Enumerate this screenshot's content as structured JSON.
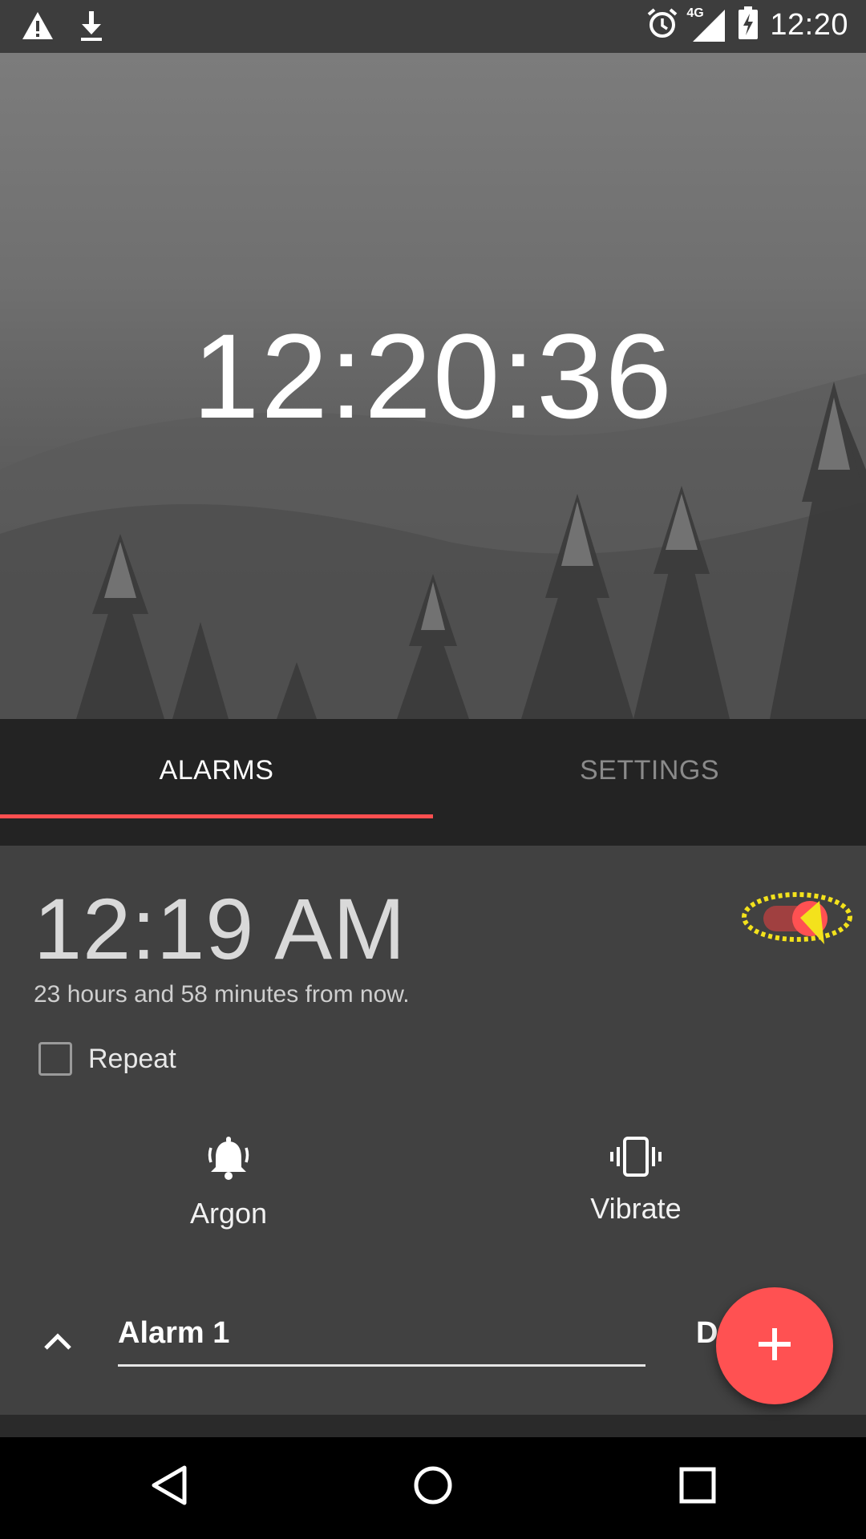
{
  "status_bar": {
    "time": "12:20",
    "network": "4G",
    "icons": [
      "warning-icon",
      "download-icon",
      "alarm-clock-icon",
      "signal-icon",
      "battery-charging-icon"
    ]
  },
  "hero": {
    "clock": "12:20:36"
  },
  "tabs": [
    {
      "label": "ALARMS",
      "active": true
    },
    {
      "label": "SETTINGS",
      "active": false
    }
  ],
  "alarm": {
    "time": "12:19 AM",
    "countdown": "23 hours and 58 minutes from now.",
    "repeat_label": "Repeat",
    "repeat_checked": false,
    "ringtone": "Argon",
    "vibrate_label": "Vibrate",
    "name": "Alarm 1",
    "delete_partial": "D",
    "enabled": true
  },
  "colors": {
    "accent": "#ff5152",
    "tab_bg": "#232323",
    "card_bg": "#414141",
    "status_bg": "#3d3d3d"
  },
  "fab": {
    "icon": "plus-icon"
  },
  "nav": {
    "icons": [
      "back-icon",
      "home-icon",
      "recents-icon"
    ]
  }
}
